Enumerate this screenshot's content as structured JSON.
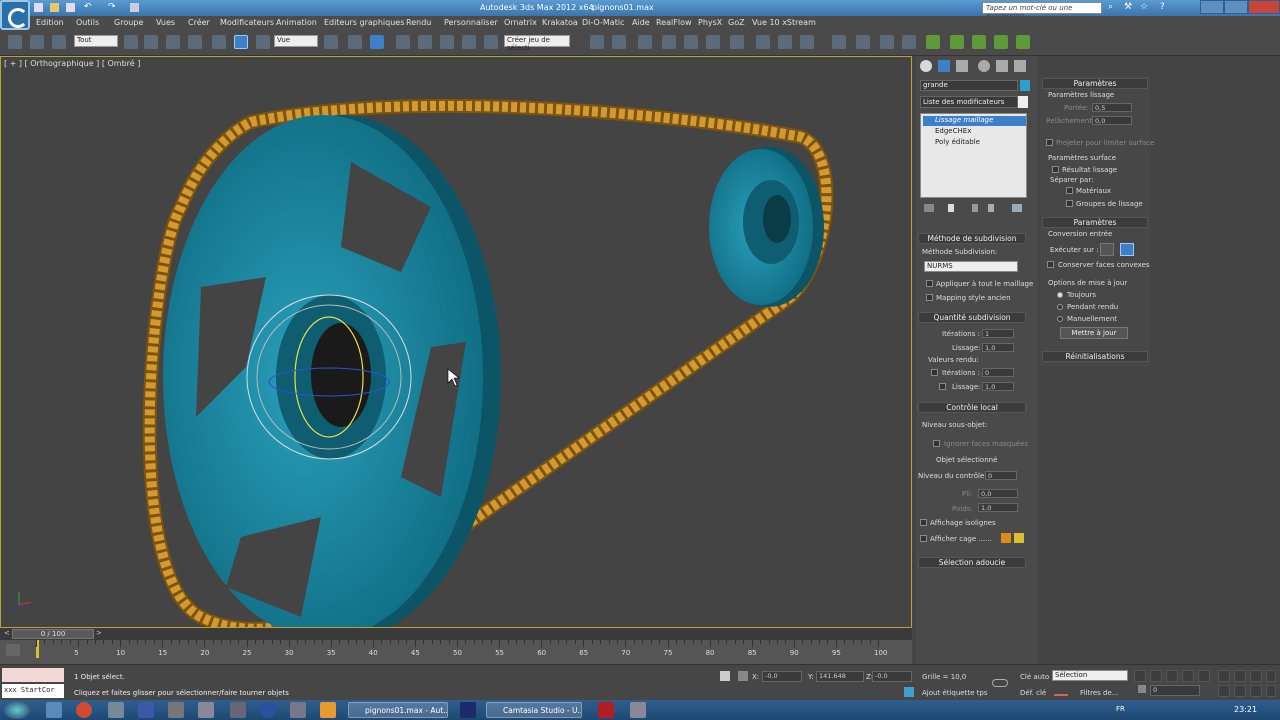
{
  "app": {
    "title": "Autodesk 3ds Max  2012 x64",
    "file": "pignons01.max",
    "search_placeholder": "Tapez un mot-clé ou une expression"
  },
  "menu": [
    "Edition",
    "Outils",
    "Groupe",
    "Vues",
    "Créer",
    "Modificateurs",
    "Animation",
    "Editeurs graphiques",
    "Rendu",
    "Personnaliser",
    "Ornatrix",
    "Krakatoa",
    "Di-O-Matic",
    "Aide",
    "RealFlow",
    "PhysX",
    "GoZ",
    "Vue 10 xStream"
  ],
  "toolbar": {
    "selection_filter": "Tout",
    "ref_coord": "Vue",
    "named_selection": "Créer jeu de sélecti"
  },
  "viewport": {
    "label": "[ + ] [ Orthographique ] [ Ombré ]"
  },
  "command_panel": {
    "object_name": "grande",
    "modifier_list": "Liste des modificateurs",
    "stack": [
      "Lissage maillage",
      "EdgeCHEx",
      "Poly éditable"
    ],
    "subdivision_method": {
      "header": "Méthode de subdivision",
      "label": "Méthode Subdivision:",
      "value": "NURMS",
      "apply_whole": "Appliquer à tout le maillage",
      "old_mapping": "Mapping style ancien"
    },
    "subdivision_amount": {
      "header": "Quantité subdivision",
      "iterations_label": "Itérations :",
      "iterations": "1",
      "smoothness_label": "Lissage:",
      "smoothness": "1,0",
      "render_values": "Valeurs rendu:",
      "r_iterations_label": "Itérations :",
      "r_iterations": "0",
      "r_smoothness_label": "Lissage:",
      "r_smoothness": "1,0"
    },
    "local_control": {
      "header": "Contrôle local",
      "sublevel": "Niveau sous-objet:",
      "ignore_backfacing": "Ignorer faces masquées",
      "selected_object": "Objet sélectionné",
      "control_level_label": "Niveau du contrôle :",
      "control_level": "0",
      "crease_label": "Pli:",
      "crease": "0,0",
      "weight_label": "Poids:",
      "weight": "1,0",
      "isoline": "Affichage isolignes",
      "show_cage": "Afficher cage ......"
    },
    "soft_selection": "Sélection adoucie"
  },
  "right_panel": {
    "params_header": "Paramètres",
    "smoothing_params": "Paramètres lissage",
    "strength_label": "Portée:",
    "strength": "0,5",
    "relax_label": "Relâchement:",
    "relax": "0,0",
    "project_surface": "Projeter pour limiter surface",
    "surface_params": "Paramètres surface",
    "smooth_result": "Résultat lissage",
    "separate_by": "Séparer par:",
    "materials": "Matériaux",
    "smoothing_groups": "Groupes de lissage",
    "params_header2": "Paramètres",
    "input_conversion": "Conversion entrée",
    "operate_on": "Exécuter sur :",
    "keep_convex": "Conserver faces convexes",
    "update_options": "Options de mise à jour",
    "always": "Toujours",
    "when_rendering": "Pendant rendu",
    "manually": "Manuellement",
    "update_btn": "Mettre à jour",
    "resets": "Réinitialisations"
  },
  "timeline": {
    "frame": "0 / 100",
    "ticks": [
      "5",
      "10",
      "15",
      "20",
      "25",
      "30",
      "35",
      "40",
      "45",
      "50",
      "55",
      "60",
      "65",
      "70",
      "75",
      "80",
      "85",
      "90",
      "95",
      "100"
    ]
  },
  "status": {
    "script_label": "xxx StartCor",
    "selected": "1 Objet sélect.",
    "prompt": "Cliquez et faites glisser pour sélectionner/faire tourner objets",
    "x_label": "X:",
    "x": "-0.0",
    "y_label": "Y:",
    "y": "141.648",
    "z_label": "Z:",
    "z": "-0.0",
    "grid": "Grille = 10,0",
    "add_tag": "Ajout étiquette tps",
    "auto_key": "Clé auto",
    "set_key": "Déf. clé",
    "selection": "Sélection",
    "key_filters": "Filtres de...",
    "frame_value": "0"
  },
  "taskbar": {
    "items": [
      "pignons01.max - Aut...",
      "Camtasia Studio - U..."
    ],
    "lang": "FR",
    "time": "23:21"
  },
  "colors": {
    "gear": "#1a8aa2",
    "chain": "#d49a30",
    "titlebar": "#4a86c0"
  }
}
